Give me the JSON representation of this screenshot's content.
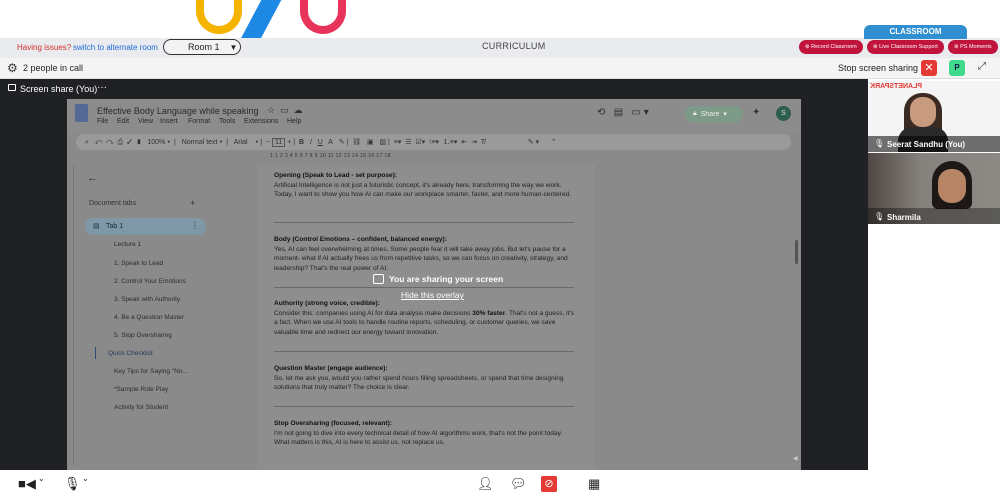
{
  "top": {
    "issues_text": "Having issues?",
    "alt_room_link": "switch to alternate room",
    "room_select": "Room 1",
    "curriculum": "CURRICULUM",
    "classroom_tab": "CLASSROOM",
    "pills": [
      "Record Classroom",
      "Live Classroom Support",
      "PS Moments"
    ]
  },
  "callbar": {
    "people_count": "2 people in call",
    "stop_sharing": "Stop screen sharing",
    "p_button": "P"
  },
  "stage": {
    "share_label": "Screen share (You)",
    "share_more": "···",
    "overlay_message": "You are sharing your screen",
    "overlay_hide": "Hide this overlay"
  },
  "doc": {
    "title": "Effective Body Language while speaking",
    "menu": [
      "File",
      "Edit",
      "View",
      "Insert",
      "Format",
      "Tools",
      "Extensions",
      "Help"
    ],
    "share_button": "Share",
    "avatar": "S",
    "toolbar_zoom": "100%",
    "toolbar_style": "Normal text",
    "toolbar_font": "Arial",
    "toolbar_size": "11",
    "ruler": "1   1   2   3   4   5   6   7   8   9   10   11   12   13   14   15   16   17   18",
    "doc_tabs_label": "Document tabs",
    "tab1": "Tab 1",
    "outline": [
      "Lecture 1",
      "1. Speak to Lead",
      "2. Control Your Emotions",
      "3. Speak with Authority",
      "4. Be a Question Master",
      "5. Stop Oversharing"
    ],
    "quick_checklist": "Quick Checklist",
    "sub_items": [
      "Key Tips for Saying \"No...",
      "*Sample Role Play",
      "Activity for Student"
    ],
    "sections": [
      {
        "heading": "Opening (Speak to Lead - set purpose):",
        "body": "Artificial Intelligence is not just a futuristic concept, it's already here, transforming the way we work. Today, I want to show you how AI can make our workplace smarter, faster, and more human-centered."
      },
      {
        "heading": "Body (Control Emotions – confident, balanced energy):",
        "body": "Yes, AI can feel overwhelming at times. Some people fear it will take away jobs. But let's pause for a moment- what if AI actually frees us from repetitive tasks, so we can focus on creativity, strategy, and leadership? That's the real power of AI."
      },
      {
        "heading": "Authority (strong voice, credible):",
        "body_pre": "Consider this: companies using AI for data analysis make decisions ",
        "body_bold": "30% faster",
        "body_post": ". That's not a guess, it's a fact. When we use AI tools to handle routine reports, scheduling, or customer queries, we save valuable time and redirect our energy toward innovation."
      },
      {
        "heading": "Question Master (engage audience):",
        "body": "So, let me ask you, would you rather spend hours filling spreadsheets, or spend that time designing solutions that truly matter? The choice is clear."
      },
      {
        "heading": "Stop Oversharing (focused, relevant):",
        "body": "I'm not going to dive into every technical detail of how AI algorithms work, that's not the point today. What matters is this, AI is here to assist us, not replace us."
      }
    ]
  },
  "participants": [
    {
      "name": "Seerat Sandhu (You)",
      "brand": "PLANETSPARK"
    },
    {
      "name": "Sharmila"
    }
  ],
  "colors": {
    "stage_bg": "#1f2124",
    "accent_red": "#c0143c",
    "classroom_blue": "#2f8fd1",
    "stop_red": "#e53935",
    "p_green": "#41d98c"
  }
}
